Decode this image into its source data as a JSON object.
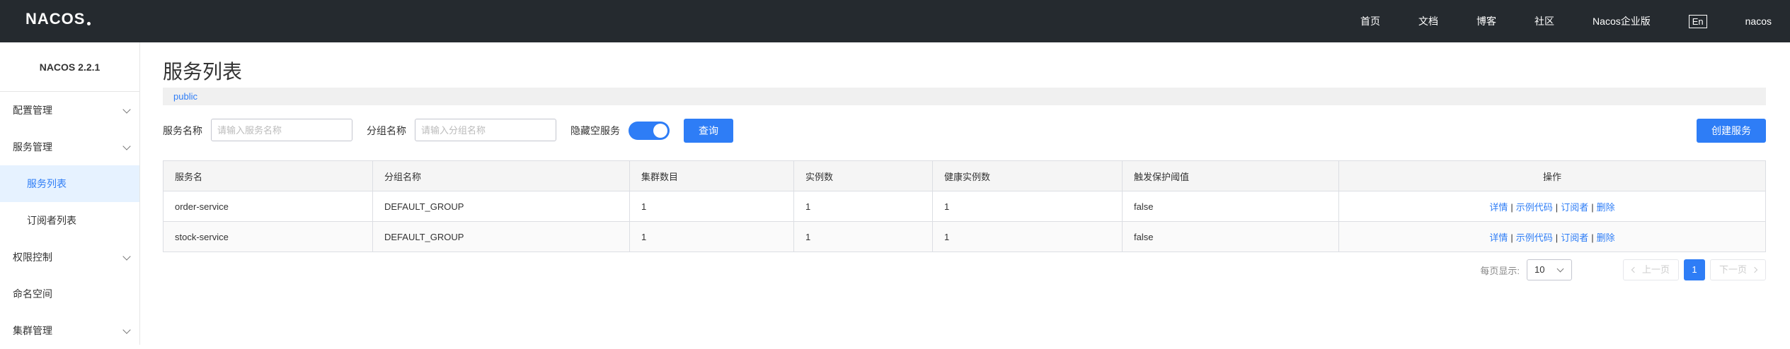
{
  "header": {
    "logo_text": "NACOS",
    "nav": [
      "首页",
      "文档",
      "博客",
      "社区",
      "Nacos企业版"
    ],
    "lang_button": "En",
    "user": "nacos"
  },
  "sidebar": {
    "title": "NACOS 2.2.1",
    "items": [
      {
        "label": "配置管理",
        "has_children": true
      },
      {
        "label": "服务管理",
        "has_children": true
      },
      {
        "label": "服务列表",
        "sub": true,
        "active": true
      },
      {
        "label": "订阅者列表",
        "sub": true
      },
      {
        "label": "权限控制",
        "has_children": true
      },
      {
        "label": "命名空间"
      },
      {
        "label": "集群管理",
        "has_children": true
      }
    ]
  },
  "main": {
    "title": "服务列表",
    "namespace": "public",
    "filter": {
      "service_name_label": "服务名称",
      "service_name_placeholder": "请输入服务名称",
      "group_name_label": "分组名称",
      "group_name_placeholder": "请输入分组名称",
      "hide_empty_label": "隐藏空服务",
      "hide_empty_on": true,
      "query_button": "查询",
      "create_button": "创建服务"
    },
    "table": {
      "headers": [
        "服务名",
        "分组名称",
        "集群数目",
        "实例数",
        "健康实例数",
        "触发保护阈值",
        "操作"
      ],
      "rows": [
        {
          "service": "order-service",
          "group": "DEFAULT_GROUP",
          "clusters": "1",
          "instances": "1",
          "healthy": "1",
          "protect": "false"
        },
        {
          "service": "stock-service",
          "group": "DEFAULT_GROUP",
          "clusters": "1",
          "instances": "1",
          "healthy": "1",
          "protect": "false"
        }
      ],
      "ops": {
        "detail": "详情",
        "sample_code": "示例代码",
        "subscribers": "订阅者",
        "delete": "删除",
        "separator": "|"
      }
    },
    "pagination": {
      "per_page_label": "每页显示:",
      "per_page_value": "10",
      "prev": "上一页",
      "current_page": "1",
      "next": "下一页"
    }
  },
  "colors": {
    "topbar": "#252a2f",
    "accent": "#2e7df6",
    "active_bg": "#e6f2ff"
  }
}
